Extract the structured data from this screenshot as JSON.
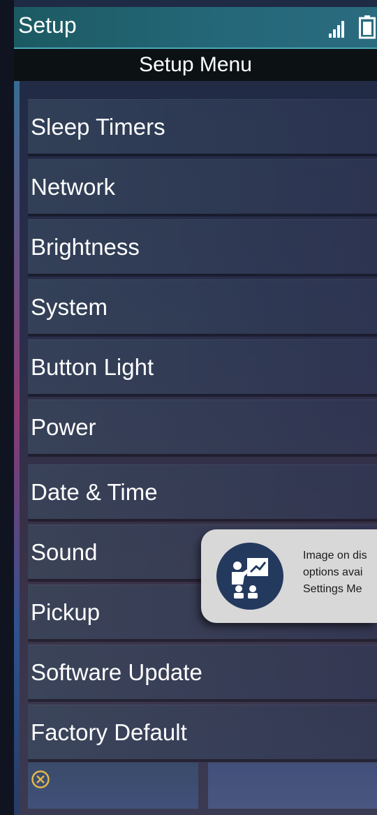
{
  "status_bar": {
    "title": "Setup",
    "signal_icon": "signal-bars-icon",
    "battery_icon": "battery-icon"
  },
  "menu": {
    "title": "Setup Menu",
    "items": [
      {
        "label": "Sleep Timers"
      },
      {
        "label": "Network"
      },
      {
        "label": "Brightness"
      },
      {
        "label": "System"
      },
      {
        "label": "Button Light"
      },
      {
        "label": "Power"
      },
      {
        "label": "Date & Time"
      },
      {
        "label": "Sound"
      },
      {
        "label": "Pickup"
      },
      {
        "label": "Software Update"
      },
      {
        "label": "Factory Default"
      }
    ]
  },
  "softkeys": {
    "left_icon": "cancel-circle-icon",
    "right_label": ""
  },
  "tooltip": {
    "icon": "presentation-teacher-icon",
    "lines": [
      "Image on dis",
      "options avai",
      "Settings Me"
    ]
  },
  "colors": {
    "status_bar": "#25687a",
    "accent_cancel": "#e0b84a",
    "tooltip_bg": "#d8d8d8",
    "tooltip_icon_bg": "#24395e"
  }
}
